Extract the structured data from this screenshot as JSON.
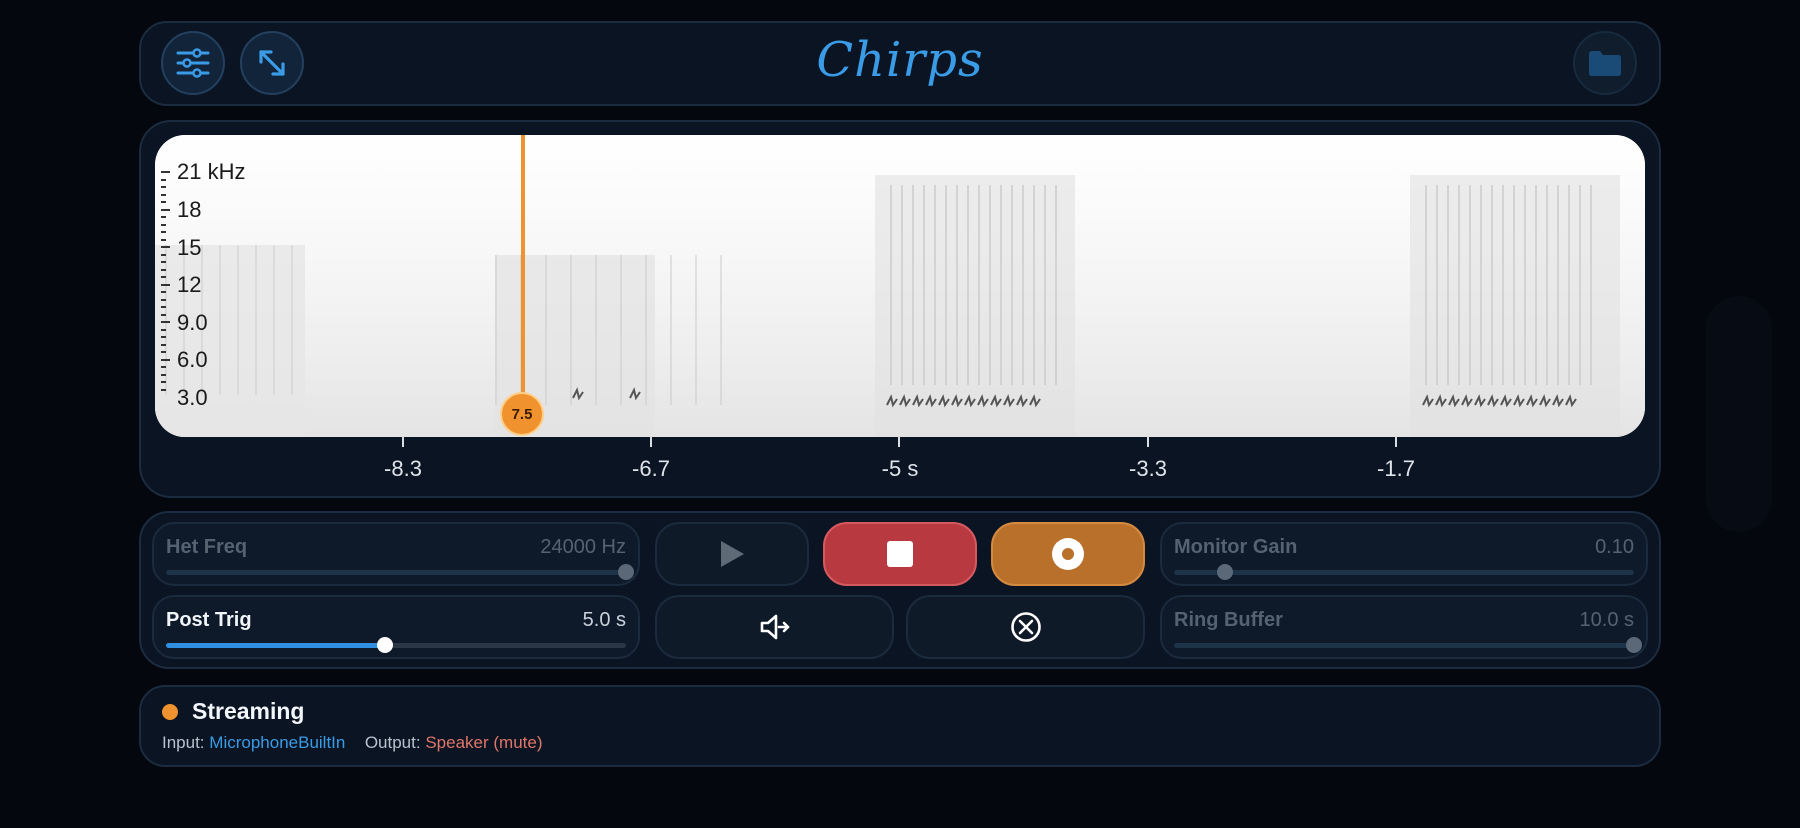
{
  "header": {
    "title": "Chirps"
  },
  "spectrogram": {
    "y_labels": [
      "21 kHz",
      "18",
      "15",
      "12",
      "9.0",
      "6.0",
      "3.0"
    ],
    "x_labels": [
      "-8.3",
      "-6.7",
      "-5 s",
      "-3.3",
      "-1.7"
    ],
    "playhead_label": "7.5"
  },
  "controls": {
    "het_freq": {
      "label": "Het Freq",
      "value": "24000 Hz",
      "level": 1.0
    },
    "post_trig": {
      "label": "Post Trig",
      "value": "5.0 s",
      "level": 0.475
    },
    "monitor_gain": {
      "label": "Monitor Gain",
      "value": "0.10",
      "level": 0.11
    },
    "ring_buffer": {
      "label": "Ring Buffer",
      "value": "10.0 s",
      "level": 1.0
    }
  },
  "status": {
    "state": "Streaming",
    "input_label": "Input:",
    "input_value": "MicrophoneBuiltIn",
    "output_label": "Output:",
    "output_value": "Speaker (mute)"
  },
  "colors": {
    "accent": "#3a9be6",
    "stop": "#b83a40",
    "record": "#b9702a",
    "playhead": "#f0922e",
    "output": "#e0766a"
  },
  "icons": [
    "sliders-icon",
    "expand-icon",
    "folder-icon",
    "play-icon",
    "stop-icon",
    "record-icon",
    "speaker-mute-icon",
    "clear-icon"
  ]
}
